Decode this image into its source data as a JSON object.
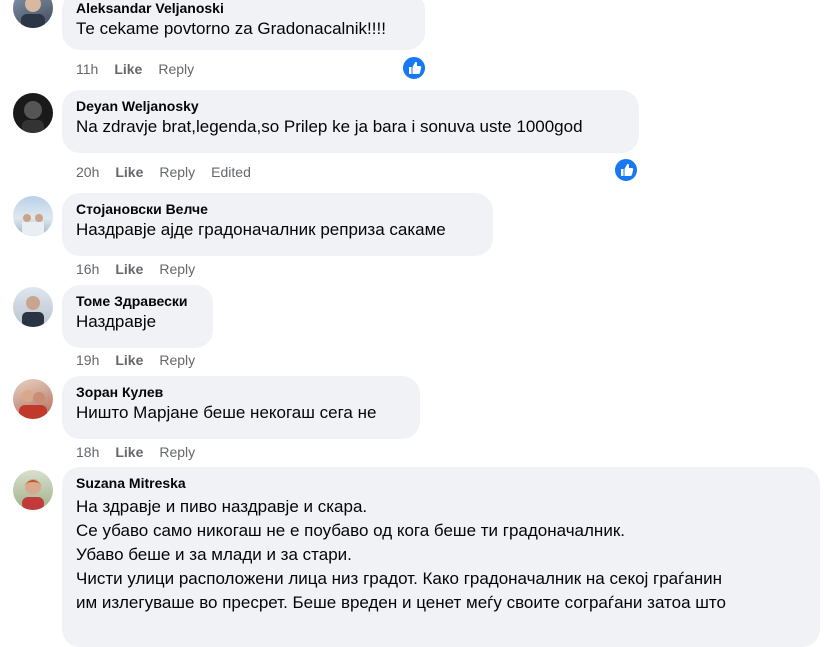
{
  "comments": [
    {
      "author": "Aleksandar Veljanoski",
      "text": [
        "Те cekame povtorno za Gradonacalnik!!!!"
      ],
      "time": "11h",
      "like": "Like",
      "reply": "Reply",
      "edited": "",
      "reaction": "like-icon"
    },
    {
      "author": "Deyan Weljanosky",
      "text": [
        "Na zdravje brat,legenda,so Prilep ke ja bara i sonuva uste 1000god"
      ],
      "time": "20h",
      "like": "Like",
      "reply": "Reply",
      "edited": "Edited",
      "reaction": "like-icon"
    },
    {
      "author": "Стојановски Велче",
      "text": [
        "Наздравје ајде градоначалник реприза сакаме"
      ],
      "time": "16h",
      "like": "Like",
      "reply": "Reply",
      "edited": ""
    },
    {
      "author": "Томе Здравески",
      "text": [
        "Наздравје"
      ],
      "time": "19h",
      "like": "Like",
      "reply": "Reply",
      "edited": ""
    },
    {
      "author": "Зоран Кулев",
      "text": [
        "Ништо Марјане беше некогаш сега не"
      ],
      "time": "18h",
      "like": "Like",
      "reply": "Reply",
      "edited": ""
    },
    {
      "author": "Suzana Mitreska",
      "text": [
        "На здравје и пиво наздравје и скара.",
        "Се убаво само никогаш не е поубаво од кога беше ти градоначалник.",
        "Убаво беше и за млади и за стари.",
        "Чисти улици расположени лица низ градот. Како градоначалник на секој граѓанин",
        "им излегуваше во пресрет. Беше вреден и ценет меѓу своите сограѓани затоа што"
      ]
    }
  ],
  "colors": {
    "bubble": "#f0f2f5",
    "meta": "#65676b",
    "reaction": "#1877f2"
  }
}
